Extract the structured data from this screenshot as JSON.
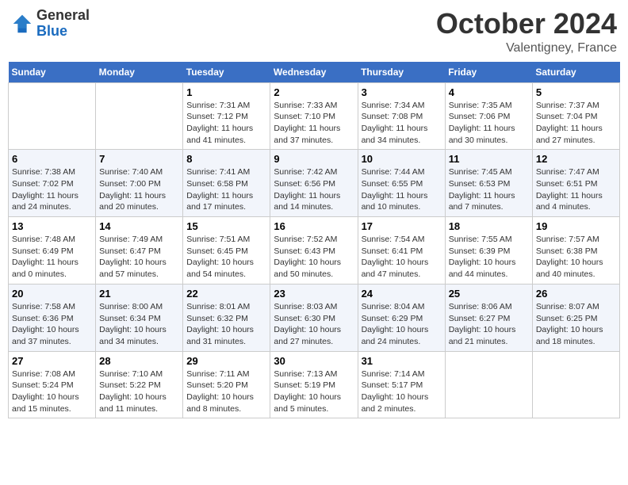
{
  "header": {
    "logo_line1": "General",
    "logo_line2": "Blue",
    "month": "October 2024",
    "location": "Valentigney, France"
  },
  "days_of_week": [
    "Sunday",
    "Monday",
    "Tuesday",
    "Wednesday",
    "Thursday",
    "Friday",
    "Saturday"
  ],
  "weeks": [
    [
      {
        "day": "",
        "info": ""
      },
      {
        "day": "",
        "info": ""
      },
      {
        "day": "1",
        "info": "Sunrise: 7:31 AM\nSunset: 7:12 PM\nDaylight: 11 hours and 41 minutes."
      },
      {
        "day": "2",
        "info": "Sunrise: 7:33 AM\nSunset: 7:10 PM\nDaylight: 11 hours and 37 minutes."
      },
      {
        "day": "3",
        "info": "Sunrise: 7:34 AM\nSunset: 7:08 PM\nDaylight: 11 hours and 34 minutes."
      },
      {
        "day": "4",
        "info": "Sunrise: 7:35 AM\nSunset: 7:06 PM\nDaylight: 11 hours and 30 minutes."
      },
      {
        "day": "5",
        "info": "Sunrise: 7:37 AM\nSunset: 7:04 PM\nDaylight: 11 hours and 27 minutes."
      }
    ],
    [
      {
        "day": "6",
        "info": "Sunrise: 7:38 AM\nSunset: 7:02 PM\nDaylight: 11 hours and 24 minutes."
      },
      {
        "day": "7",
        "info": "Sunrise: 7:40 AM\nSunset: 7:00 PM\nDaylight: 11 hours and 20 minutes."
      },
      {
        "day": "8",
        "info": "Sunrise: 7:41 AM\nSunset: 6:58 PM\nDaylight: 11 hours and 17 minutes."
      },
      {
        "day": "9",
        "info": "Sunrise: 7:42 AM\nSunset: 6:56 PM\nDaylight: 11 hours and 14 minutes."
      },
      {
        "day": "10",
        "info": "Sunrise: 7:44 AM\nSunset: 6:55 PM\nDaylight: 11 hours and 10 minutes."
      },
      {
        "day": "11",
        "info": "Sunrise: 7:45 AM\nSunset: 6:53 PM\nDaylight: 11 hours and 7 minutes."
      },
      {
        "day": "12",
        "info": "Sunrise: 7:47 AM\nSunset: 6:51 PM\nDaylight: 11 hours and 4 minutes."
      }
    ],
    [
      {
        "day": "13",
        "info": "Sunrise: 7:48 AM\nSunset: 6:49 PM\nDaylight: 11 hours and 0 minutes."
      },
      {
        "day": "14",
        "info": "Sunrise: 7:49 AM\nSunset: 6:47 PM\nDaylight: 10 hours and 57 minutes."
      },
      {
        "day": "15",
        "info": "Sunrise: 7:51 AM\nSunset: 6:45 PM\nDaylight: 10 hours and 54 minutes."
      },
      {
        "day": "16",
        "info": "Sunrise: 7:52 AM\nSunset: 6:43 PM\nDaylight: 10 hours and 50 minutes."
      },
      {
        "day": "17",
        "info": "Sunrise: 7:54 AM\nSunset: 6:41 PM\nDaylight: 10 hours and 47 minutes."
      },
      {
        "day": "18",
        "info": "Sunrise: 7:55 AM\nSunset: 6:39 PM\nDaylight: 10 hours and 44 minutes."
      },
      {
        "day": "19",
        "info": "Sunrise: 7:57 AM\nSunset: 6:38 PM\nDaylight: 10 hours and 40 minutes."
      }
    ],
    [
      {
        "day": "20",
        "info": "Sunrise: 7:58 AM\nSunset: 6:36 PM\nDaylight: 10 hours and 37 minutes."
      },
      {
        "day": "21",
        "info": "Sunrise: 8:00 AM\nSunset: 6:34 PM\nDaylight: 10 hours and 34 minutes."
      },
      {
        "day": "22",
        "info": "Sunrise: 8:01 AM\nSunset: 6:32 PM\nDaylight: 10 hours and 31 minutes."
      },
      {
        "day": "23",
        "info": "Sunrise: 8:03 AM\nSunset: 6:30 PM\nDaylight: 10 hours and 27 minutes."
      },
      {
        "day": "24",
        "info": "Sunrise: 8:04 AM\nSunset: 6:29 PM\nDaylight: 10 hours and 24 minutes."
      },
      {
        "day": "25",
        "info": "Sunrise: 8:06 AM\nSunset: 6:27 PM\nDaylight: 10 hours and 21 minutes."
      },
      {
        "day": "26",
        "info": "Sunrise: 8:07 AM\nSunset: 6:25 PM\nDaylight: 10 hours and 18 minutes."
      }
    ],
    [
      {
        "day": "27",
        "info": "Sunrise: 7:08 AM\nSunset: 5:24 PM\nDaylight: 10 hours and 15 minutes."
      },
      {
        "day": "28",
        "info": "Sunrise: 7:10 AM\nSunset: 5:22 PM\nDaylight: 10 hours and 11 minutes."
      },
      {
        "day": "29",
        "info": "Sunrise: 7:11 AM\nSunset: 5:20 PM\nDaylight: 10 hours and 8 minutes."
      },
      {
        "day": "30",
        "info": "Sunrise: 7:13 AM\nSunset: 5:19 PM\nDaylight: 10 hours and 5 minutes."
      },
      {
        "day": "31",
        "info": "Sunrise: 7:14 AM\nSunset: 5:17 PM\nDaylight: 10 hours and 2 minutes."
      },
      {
        "day": "",
        "info": ""
      },
      {
        "day": "",
        "info": ""
      }
    ]
  ]
}
